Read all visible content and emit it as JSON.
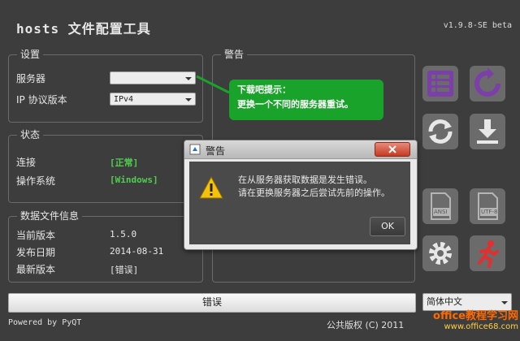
{
  "app": {
    "title": "hosts 文件配置工具",
    "version": "v1.9.8-SE beta"
  },
  "settings": {
    "title": "设置",
    "server_label": "服务器",
    "ip_label": "IP 协议版本",
    "server_value": "",
    "ip_value": "IPv4"
  },
  "status": {
    "title": "状态",
    "conn_label": "连接",
    "conn_value": "[正常]",
    "os_label": "操作系统",
    "os_value": "[Windows]"
  },
  "datafile": {
    "title": "数据文件信息",
    "current_label": "当前版本",
    "current_value": "1.5.0",
    "date_label": "发布日期",
    "date_value": "2014-08-31",
    "latest_label": "最新版本",
    "latest_value": "[错误]"
  },
  "warn_group": {
    "title": "警告"
  },
  "tip": {
    "line1": "下载吧提示：",
    "line2": "更换一个不同的服务器重试。"
  },
  "dialog": {
    "title": "警告",
    "line1": "在从服务器获取数据是发生错误。",
    "line2": "请在更换服务器之后尝试先前的操作。",
    "ok_label": "OK"
  },
  "tiles": [
    {
      "icon": "list-icon",
      "label": ""
    },
    {
      "icon": "refresh-icon",
      "label": ""
    },
    {
      "icon": "sync-icon",
      "label": ""
    },
    {
      "icon": "download-icon",
      "label": ""
    },
    {
      "icon": "ansi-file-icon",
      "label": "ANSI"
    },
    {
      "icon": "utf8-file-icon",
      "label": "UTF-8"
    },
    {
      "icon": "gear-icon",
      "label": ""
    },
    {
      "icon": "exit-run-icon",
      "label": ""
    }
  ],
  "progress_bar": {
    "text": "错误"
  },
  "language": {
    "value": "简体中文"
  },
  "footer": {
    "left": "Powered by PyQT",
    "right": "公共版权 (C) 2011",
    "watermark": "office教程学习网",
    "watermark_url": "www.office68.com"
  },
  "colors": {
    "accent_purple": "#7b3fa8",
    "tip_green": "#1aa32a",
    "status_green": "#4fce4f",
    "exit_red": "#e03030"
  }
}
